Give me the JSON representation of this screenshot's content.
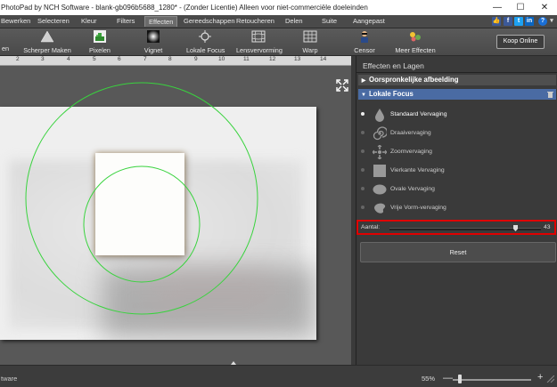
{
  "window": {
    "title": "PhotoPad by NCH Software - blank-gb096b5688_1280* - (Zonder Licentie) Alleen voor niet-commerciële doeleinden",
    "minimize": "—",
    "maximize": "☐",
    "close": "✕"
  },
  "menu": [
    "Bewerken",
    "Selecteren",
    "Kleur",
    "Filters",
    "Effecten",
    "Gereedschappen",
    "Retoucheren",
    "Delen",
    "Suite",
    "Aangepast"
  ],
  "menu_active": "Effecten",
  "social": {
    "like": "👍",
    "facebook": "f",
    "twitter": "t",
    "linkedin": "in",
    "help": "?",
    "help_caret": "▾"
  },
  "toolbar": {
    "items": [
      {
        "label": "en",
        "icon": "partial-tool-icon"
      },
      {
        "label": "Scherper Maken",
        "icon": "sharpen-icon"
      },
      {
        "label": "Pixelen",
        "icon": "pixelate-icon"
      },
      {
        "label": "Vignet",
        "icon": "vignette-icon"
      },
      {
        "label": "Lokale Focus",
        "icon": "local-focus-icon"
      },
      {
        "label": "Lensvervorming",
        "icon": "lens-distortion-icon"
      },
      {
        "label": "Warp",
        "icon": "warp-icon"
      },
      {
        "label": "Censor",
        "icon": "censor-icon"
      },
      {
        "label": "Meer Effecten",
        "icon": "more-effects-icon"
      }
    ],
    "buy_label": "Koop Online"
  },
  "ruler": {
    "ticks": [
      "2",
      "3",
      "4",
      "5",
      "6",
      "7",
      "8",
      "9",
      "10",
      "11",
      "12",
      "13",
      "14"
    ]
  },
  "panel": {
    "title": "Effecten en Lagen",
    "original_section": "Oorspronkelijke afbeelding",
    "focus_section": "Lokale Focus",
    "options": [
      {
        "label": "Standaard Vervaging",
        "icon": "drop-icon",
        "selected": true
      },
      {
        "label": "Draaivervaging",
        "icon": "spiral-icon",
        "selected": false
      },
      {
        "label": "Zoomvervaging",
        "icon": "zoom-blur-icon",
        "selected": false
      },
      {
        "label": "Vierkante Vervaging",
        "icon": "square-icon",
        "selected": false
      },
      {
        "label": "Ovale Vervaging",
        "icon": "oval-icon",
        "selected": false
      },
      {
        "label": "Vrije Vorm-vervaging",
        "icon": "freeform-icon",
        "selected": false
      }
    ],
    "amount_label": "Aantal:",
    "amount_value": "43",
    "reset_label": "Reset"
  },
  "status": {
    "left_text": "tware",
    "zoom": "55%",
    "zoom_minus": "—",
    "zoom_plus": "+"
  }
}
